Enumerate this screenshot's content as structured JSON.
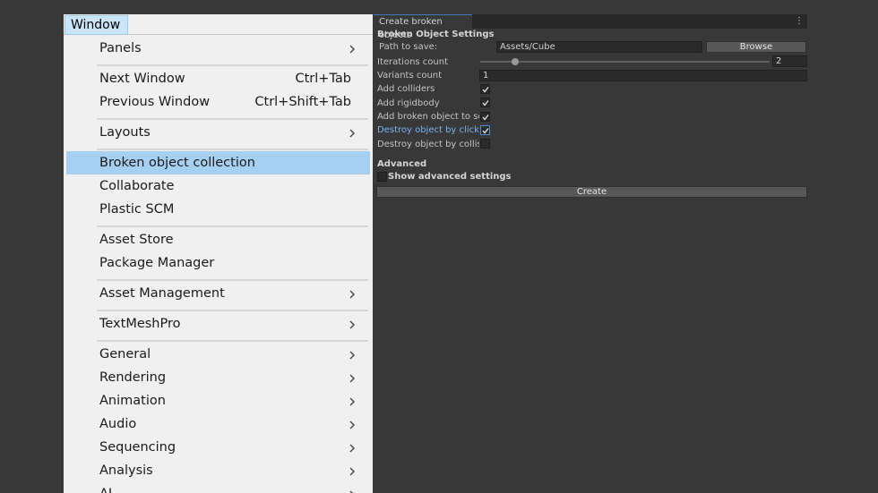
{
  "menu": {
    "title": "Window",
    "items": [
      {
        "label": "Panels",
        "shortcut": "",
        "submenu": true
      },
      {
        "label": "Next Window",
        "shortcut": "Ctrl+Tab",
        "submenu": false
      },
      {
        "label": "Previous Window",
        "shortcut": "Ctrl+Shift+Tab",
        "submenu": false
      },
      {
        "label": "Layouts",
        "shortcut": "",
        "submenu": true
      },
      {
        "label": "Broken object collection",
        "shortcut": "",
        "submenu": false,
        "highlighted": true
      },
      {
        "label": "Collaborate",
        "shortcut": "",
        "submenu": false
      },
      {
        "label": "Plastic SCM",
        "shortcut": "",
        "submenu": false
      },
      {
        "label": "Asset Store",
        "shortcut": "",
        "submenu": false
      },
      {
        "label": "Package Manager",
        "shortcut": "",
        "submenu": false
      },
      {
        "label": "Asset Management",
        "shortcut": "",
        "submenu": true
      },
      {
        "label": "TextMeshPro",
        "shortcut": "",
        "submenu": true
      },
      {
        "label": "General",
        "shortcut": "",
        "submenu": true
      },
      {
        "label": "Rendering",
        "shortcut": "",
        "submenu": true
      },
      {
        "label": "Animation",
        "shortcut": "",
        "submenu": true
      },
      {
        "label": "Audio",
        "shortcut": "",
        "submenu": true
      },
      {
        "label": "Sequencing",
        "shortcut": "",
        "submenu": true
      },
      {
        "label": "Analysis",
        "shortcut": "",
        "submenu": true
      },
      {
        "label": "AI",
        "shortcut": "",
        "submenu": true
      }
    ]
  },
  "panel": {
    "tab_title": "Create broken objects",
    "kebab": "⋮",
    "section_title": "Broken Object Settings",
    "path_label": "Path to save:",
    "path_value": "Assets/Cube",
    "browse_label": "Browse",
    "iterations_label": "Iterations count",
    "iterations_value": "2",
    "iterations_fraction": 0.12,
    "variants_label": "Variants count",
    "variants_value": "1",
    "checkboxes": [
      {
        "label": "Add colliders",
        "checked": true
      },
      {
        "label": "Add rigidbody",
        "checked": true
      },
      {
        "label": "Add broken object to scene",
        "checked": true
      },
      {
        "label": "Destroy object by click",
        "checked": true
      },
      {
        "label": "Destroy object by collision",
        "checked": false
      }
    ],
    "advanced_title": "Advanced",
    "show_advanced_label": "Show advanced settings",
    "show_advanced_checked": false,
    "create_label": "Create"
  },
  "colors": {
    "menu_bg": "#f0f0f0",
    "menu_highlight": "#a6d0f2",
    "editor_bg": "#383838",
    "accent_blue": "#7bb3f0"
  }
}
